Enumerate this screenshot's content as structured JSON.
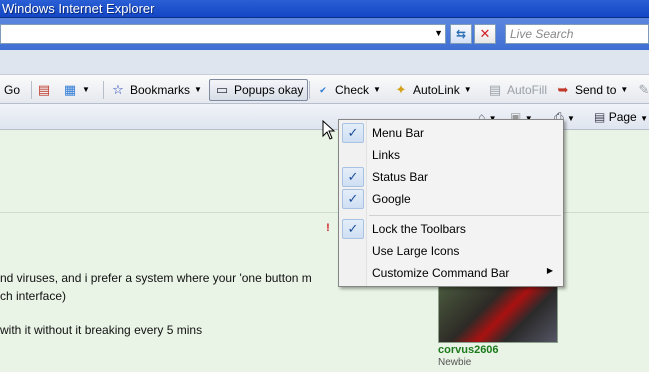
{
  "window": {
    "title": "Windows Internet Explorer"
  },
  "addressbar": {
    "search_placeholder": "Live Search"
  },
  "toolbar": {
    "go_label": "Go",
    "bookmarks_label": "Bookmarks",
    "popups_label": "Popups okay",
    "check_label": "Check",
    "autolink_label": "AutoLink",
    "autofill_label": "AutoFill",
    "sendto_label": "Send to"
  },
  "commandbar": {
    "page_label": "Page"
  },
  "context_menu": {
    "items": [
      {
        "label": "Menu Bar",
        "checked": true
      },
      {
        "label": "Links",
        "checked": false
      },
      {
        "label": "Status Bar",
        "checked": true
      },
      {
        "label": "Google",
        "checked": true
      },
      {
        "label": "Lock the Toolbars",
        "checked": true
      },
      {
        "label": "Use Large Icons",
        "checked": false
      },
      {
        "label": "Customize Command Bar",
        "checked": false,
        "submenu": true
      }
    ]
  },
  "post": {
    "line1": "nd viruses, and i prefer a system where your 'one button m",
    "line2": "ch interface)",
    "line3": "with it without it breaking every 5 mins"
  },
  "user": {
    "name": "corvus2606",
    "rank": "Newbie"
  },
  "icons": {
    "check": "✓",
    "submenu_arrow": "▶",
    "dropdown_arrow": "▼"
  }
}
